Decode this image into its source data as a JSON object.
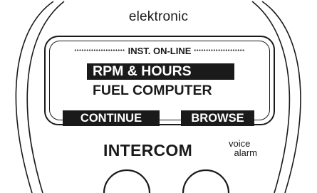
{
  "device": {
    "top_label": "elektronic",
    "brand": "INTERCOM",
    "brand_sub_line1": "voice",
    "brand_sub_line2": "alarm"
  },
  "screen": {
    "status": "INST. ON-LINE",
    "menu_items": [
      {
        "label": "RPM & HOURS",
        "selected": true
      },
      {
        "label": "FUEL COMPUTER",
        "selected": false
      }
    ],
    "softkeys": {
      "left": "CONTINUE",
      "right": "BROWSE"
    }
  },
  "colors": {
    "ink": "#1a1a1a",
    "background": "#ffffff"
  },
  "icons": {
    "left_button": "round-button-icon",
    "right_button": "round-button-icon"
  }
}
